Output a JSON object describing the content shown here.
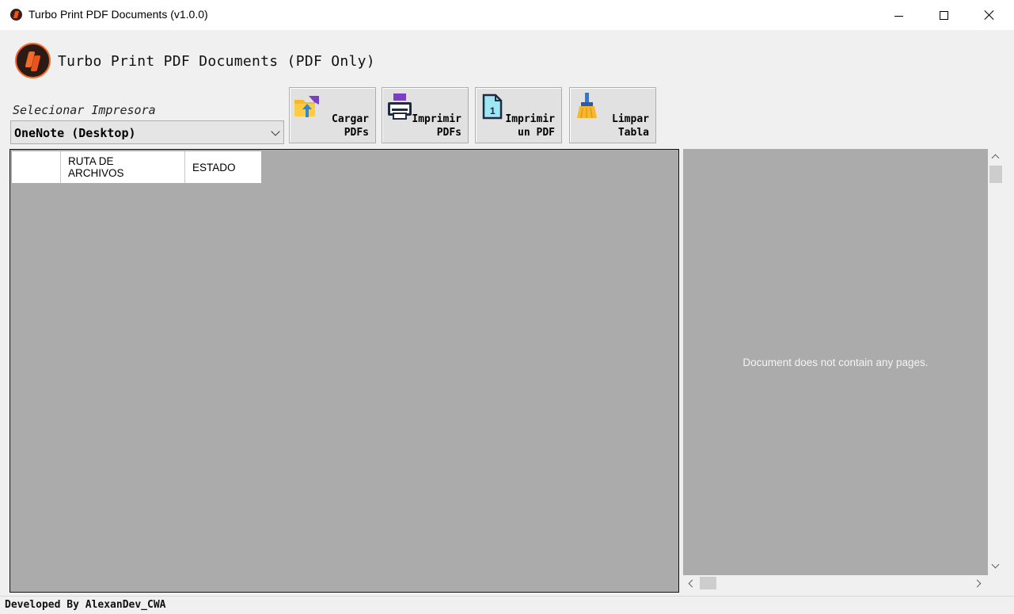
{
  "window": {
    "title": "Turbo Print PDF Documents (v1.0.0)"
  },
  "header": {
    "title": "Turbo Print PDF Documents (PDF Only)"
  },
  "printer": {
    "label": "Selecionar Impresora",
    "selected": "OneNote (Desktop)"
  },
  "toolbar": {
    "cargar_label": "Cargar\nPDFs",
    "imprimir_label": "Imprimir\nPDFs",
    "imprimir_uno_label": "Imprimir\nun PDF",
    "limpiar_label": "Limpar\nTabla"
  },
  "grid": {
    "columns": [
      "",
      "RUTA DE\nARCHIVOS",
      "ESTADO"
    ],
    "rows": []
  },
  "viewer": {
    "message": "Document does not contain any pages."
  },
  "status": {
    "text": "Developed By AlexanDev_CWA"
  },
  "icons": {
    "app": "app-logo-icon",
    "cargar": "folder-upload-icon",
    "imprimir": "printer-icon",
    "imprimir_uno": "document-one-icon",
    "limpiar": "broom-icon"
  },
  "colors": {
    "accent": "#f26a2a",
    "grid_bg": "#ababab"
  }
}
